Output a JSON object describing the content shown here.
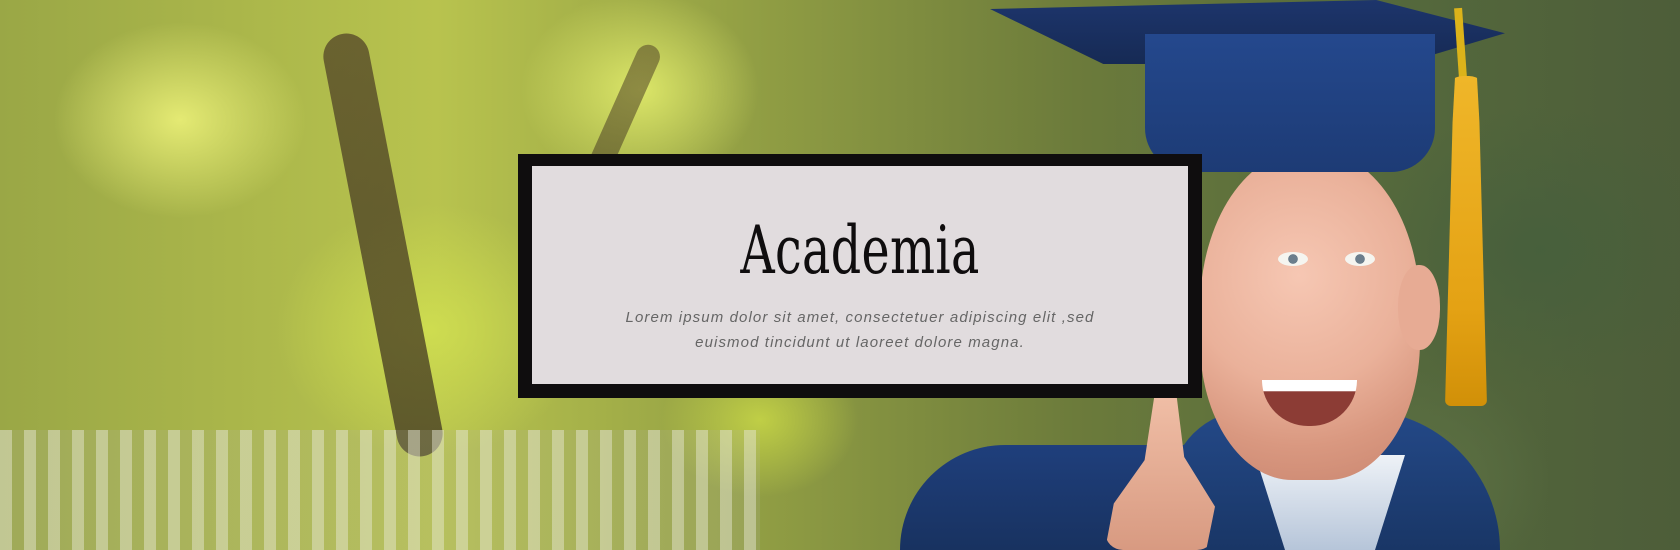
{
  "hero": {
    "title": "Academia",
    "subtitle": "Lorem ipsum dolor sit amet, consectetuer adipiscing elit ,sed euismod tincidunt ut laoreet dolore magna."
  },
  "colors": {
    "card_border": "#0f0d0e",
    "card_background": "#e1dcde",
    "title_text": "#0f0d0e",
    "subtitle_text": "#666666"
  },
  "image": {
    "subject": "graduate"
  }
}
